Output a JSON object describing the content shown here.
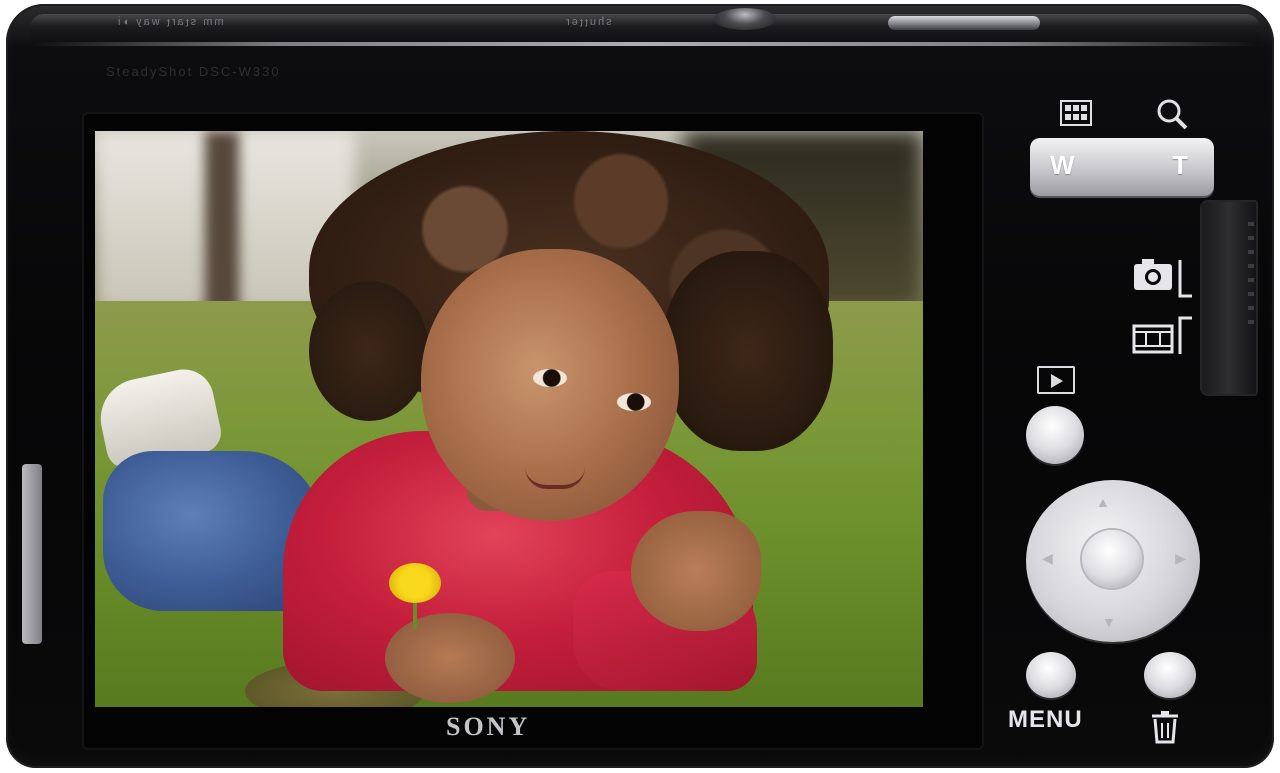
{
  "device": {
    "brand_logo": "SONY",
    "top_print_left": "ᴉ◖ ʎɐʍ ʇɹɐʇs ɯɯ",
    "top_print_right": "ɹɘʇʇnɥs",
    "model_print": "SteadyShot  DSC-W330"
  },
  "controls": {
    "zoom_w_label": "W",
    "zoom_t_label": "T",
    "zoom_wide_icon": "grid-index-icon",
    "zoom_tele_icon": "magnifier-icon",
    "mode_still_icon": "camera-icon",
    "mode_movie_icon": "film-icon",
    "playback_icon": "play-icon",
    "menu_label": "MENU",
    "delete_icon": "trash-icon"
  },
  "screen": {
    "content": "photo-of-child-lying-on-grass"
  },
  "colors": {
    "body": "#060607",
    "buttons": "#dcdce0",
    "shirt": "#c51f3c"
  }
}
